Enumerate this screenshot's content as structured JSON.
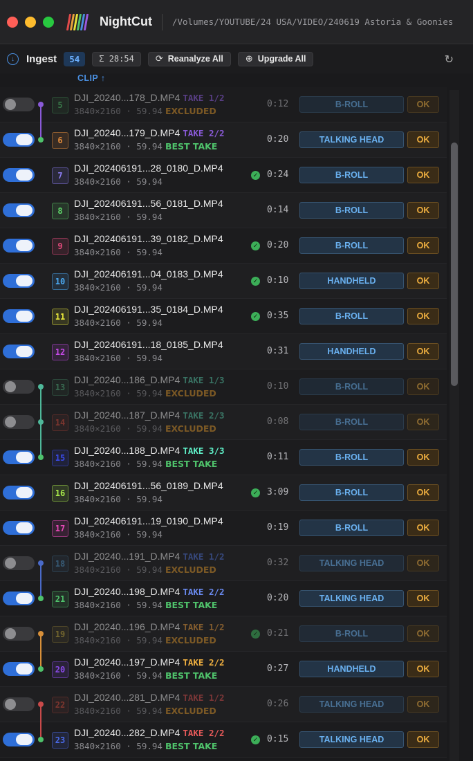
{
  "window": {
    "app_name": "NightCut",
    "path": "/Volumes/YOUTUBE/24 USA/VIDEO/240619 Astoria & Goonies"
  },
  "toolbar": {
    "ingest_label": "Ingest",
    "count": "54",
    "total_duration": "Σ 28:54",
    "reanalyze_label": "Reanalyze All",
    "upgrade_label": "Upgrade All"
  },
  "list": {
    "sort_header": "CLIP ↑",
    "rows": [
      {
        "num": "5",
        "name": "DJI_20240...178_D.MP4",
        "take": "TAKE 1/2",
        "res": "3840×2160 · 59.94",
        "status": "EXCLUDED",
        "check": false,
        "dur": "0:12",
        "cat": "B-ROLL",
        "ok": "OK",
        "on": false
      },
      {
        "num": "6",
        "name": "DJI_20240...179_D.MP4",
        "take": "TAKE 2/2",
        "res": "3840×2160 · 59.94",
        "status": "BEST TAKE",
        "check": false,
        "dur": "0:20",
        "cat": "TALKING HEAD",
        "ok": "OK",
        "on": true
      },
      {
        "num": "7",
        "name": "DJI_202406191...28_0180_D.MP4",
        "take": "",
        "res": "3840×2160 · 59.94",
        "status": "",
        "check": true,
        "dur": "0:24",
        "cat": "B-ROLL",
        "ok": "OK",
        "on": true
      },
      {
        "num": "8",
        "name": "DJI_202406191...56_0181_D.MP4",
        "take": "",
        "res": "3840×2160 · 59.94",
        "status": "",
        "check": false,
        "dur": "0:14",
        "cat": "B-ROLL",
        "ok": "OK",
        "on": true
      },
      {
        "num": "9",
        "name": "DJI_202406191...39_0182_D.MP4",
        "take": "",
        "res": "3840×2160 · 59.94",
        "status": "",
        "check": true,
        "dur": "0:20",
        "cat": "B-ROLL",
        "ok": "OK",
        "on": true
      },
      {
        "num": "10",
        "name": "DJI_202406191...04_0183_D.MP4",
        "take": "",
        "res": "3840×2160 · 59.94",
        "status": "",
        "check": true,
        "dur": "0:10",
        "cat": "HANDHELD",
        "ok": "OK",
        "on": true
      },
      {
        "num": "11",
        "name": "DJI_202406191...35_0184_D.MP4",
        "take": "",
        "res": "3840×2160 · 59.94",
        "status": "",
        "check": true,
        "dur": "0:35",
        "cat": "B-ROLL",
        "ok": "OK",
        "on": true
      },
      {
        "num": "12",
        "name": "DJI_202406191...18_0185_D.MP4",
        "take": "",
        "res": "3840×2160 · 59.94",
        "status": "",
        "check": false,
        "dur": "0:31",
        "cat": "HANDHELD",
        "ok": "OK",
        "on": true
      },
      {
        "num": "13",
        "name": "DJI_20240...186_D.MP4",
        "take": "TAKE 1/3",
        "res": "3840×2160 · 59.94",
        "status": "EXCLUDED",
        "check": false,
        "dur": "0:10",
        "cat": "B-ROLL",
        "ok": "OK",
        "on": false
      },
      {
        "num": "14",
        "name": "DJI_20240...187_D.MP4",
        "take": "TAKE 2/3",
        "res": "3840×2160 · 59.94",
        "status": "EXCLUDED",
        "check": false,
        "dur": "0:08",
        "cat": "B-ROLL",
        "ok": "OK",
        "on": false
      },
      {
        "num": "15",
        "name": "DJI_20240...188_D.MP4",
        "take": "TAKE 3/3",
        "res": "3840×2160 · 59.94",
        "status": "BEST TAKE",
        "check": false,
        "dur": "0:11",
        "cat": "B-ROLL",
        "ok": "OK",
        "on": true
      },
      {
        "num": "16",
        "name": "DJI_202406191...56_0189_D.MP4",
        "take": "",
        "res": "3840×2160 · 59.94",
        "status": "",
        "check": true,
        "dur": "3:09",
        "cat": "B-ROLL",
        "ok": "OK",
        "on": true
      },
      {
        "num": "17",
        "name": "DJI_202406191...19_0190_D.MP4",
        "take": "",
        "res": "3840×2160 · 59.94",
        "status": "",
        "check": false,
        "dur": "0:19",
        "cat": "B-ROLL",
        "ok": "OK",
        "on": true
      },
      {
        "num": "18",
        "name": "DJI_20240...191_D.MP4",
        "take": "TAKE 1/2",
        "res": "3840×2160 · 59.94",
        "status": "EXCLUDED",
        "check": false,
        "dur": "0:32",
        "cat": "TALKING HEAD",
        "ok": "OK",
        "on": false
      },
      {
        "num": "21",
        "name": "DJI_20240...198_D.MP4",
        "take": "TAKE 2/2",
        "res": "3840×2160 · 59.94",
        "status": "BEST TAKE",
        "check": false,
        "dur": "0:20",
        "cat": "TALKING HEAD",
        "ok": "OK",
        "on": true
      },
      {
        "num": "19",
        "name": "DJI_20240...196_D.MP4",
        "take": "TAKE 1/2",
        "res": "3840×2160 · 59.94",
        "status": "EXCLUDED",
        "check": true,
        "dur": "0:21",
        "cat": "B-ROLL",
        "ok": "OK",
        "on": false
      },
      {
        "num": "20",
        "name": "DJI_20240...197_D.MP4",
        "take": "TAKE 2/2",
        "res": "3840×2160 · 59.94",
        "status": "BEST TAKE",
        "check": false,
        "dur": "0:27",
        "cat": "HANDHELD",
        "ok": "OK",
        "on": true
      },
      {
        "num": "22",
        "name": "DJI_20240...281_D.MP4",
        "take": "TAKE 1/2",
        "res": "3840×2160 · 59.94",
        "status": "EXCLUDED",
        "check": false,
        "dur": "0:26",
        "cat": "TALKING HEAD",
        "ok": "OK",
        "on": false
      },
      {
        "num": "23",
        "name": "DJI_20240...282_D.MP4",
        "take": "TAKE 2/2",
        "res": "3840×2160 · 59.94",
        "status": "BEST TAKE",
        "check": true,
        "dur": "0:15",
        "cat": "TALKING HEAD",
        "ok": "OK",
        "on": true
      }
    ]
  },
  "colors": {
    "accent": "#2f6fd8",
    "num_colors": [
      "#4fc26b",
      "#e08a3a",
      "#8a7cf0",
      "#5fd46a",
      "#e04a7a",
      "#4aa8f0",
      "#e8e83a",
      "#c64ae8",
      "#4fa878",
      "#c8483a",
      "#3a4ae8",
      "#a8e84a",
      "#e84ab8",
      "#4a8ab8",
      "#4fc26b",
      "#b8a03a",
      "#8a4ae8",
      "#c8483a",
      "#4a6ae8"
    ],
    "take_colors": [
      "#8a5ad8",
      "#8a5ad8",
      "",
      "",
      "",
      "",
      "",
      "",
      "#4fb89a",
      "#4fb89a",
      "#5ff0c8",
      "",
      "",
      "#4a6ac8",
      "#6a8af0",
      "#d8903a",
      "#f0b040",
      "#c84a4a",
      "#e85a5a"
    ]
  }
}
